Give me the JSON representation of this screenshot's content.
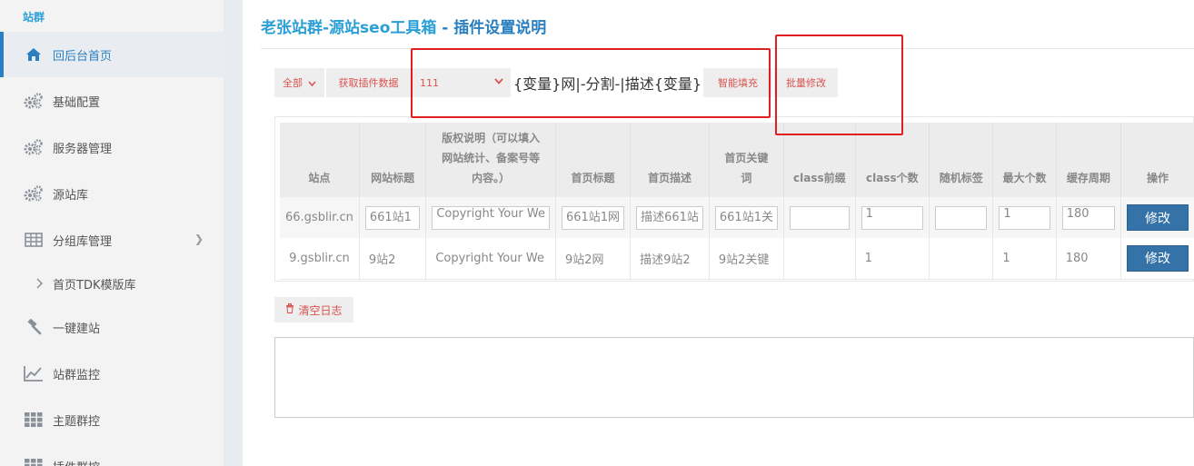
{
  "sidebar": {
    "header": "站群",
    "items": [
      {
        "label": "回后台首页",
        "icon": "home-icon"
      },
      {
        "label": "基础配置",
        "icon": "gears-icon"
      },
      {
        "label": "服务器管理",
        "icon": "gears-icon"
      },
      {
        "label": "源站库",
        "icon": "gears-icon"
      },
      {
        "label": "分组库管理",
        "icon": "table-icon"
      },
      {
        "label": "首页TDK模版库",
        "icon": "chevron-right-icon"
      },
      {
        "label": "一键建站",
        "icon": "gavel-icon"
      },
      {
        "label": "站群监控",
        "icon": "line-chart-icon"
      },
      {
        "label": "主题群控",
        "icon": "grid-icon"
      },
      {
        "label": "插件群控",
        "icon": "grid-icon"
      }
    ]
  },
  "header": {
    "title_main": "老张站群-源站seo工具箱",
    "title_sep": " - ",
    "title_sub": "插件设置说明"
  },
  "toolbar": {
    "filter_label": "全部",
    "fetch_label": "获取插件数据",
    "select_value": "111",
    "template_text": "{变量}网|-分割-|描述{变量}",
    "smart_fill_label": "智能填充",
    "batch_edit_label": "批量修改"
  },
  "table": {
    "headers": [
      "站点",
      "网站标题",
      "版权说明（可以填入网站统计、备案号等内容。）",
      "首页标题",
      "首页描述",
      "首页关键词",
      "class前缀",
      "class个数",
      "随机标签",
      "最大个数",
      "缓存周期",
      "操作"
    ],
    "rows": [
      {
        "site": "66.gsblir.cn",
        "title": "661站1",
        "copyright": "Copyright Your We",
        "home_title": "661站1网",
        "home_desc": "描述661站",
        "home_keywords": "661站1关",
        "class_prefix": "",
        "class_count": "1",
        "random_tag": "",
        "max_count": "1",
        "cache_period": "180",
        "action": "修改"
      },
      {
        "site": "9.gsblir.cn",
        "title": "9站2",
        "copyright": "Copyright Your We",
        "home_title": "9站2网",
        "home_desc": "描述9站2",
        "home_keywords": "9站2关键",
        "class_prefix": "",
        "class_count": "1",
        "random_tag": "",
        "max_count": "1",
        "cache_period": "180",
        "action": "修改"
      }
    ]
  },
  "clear_log_label": "清空日志",
  "log_text": ""
}
